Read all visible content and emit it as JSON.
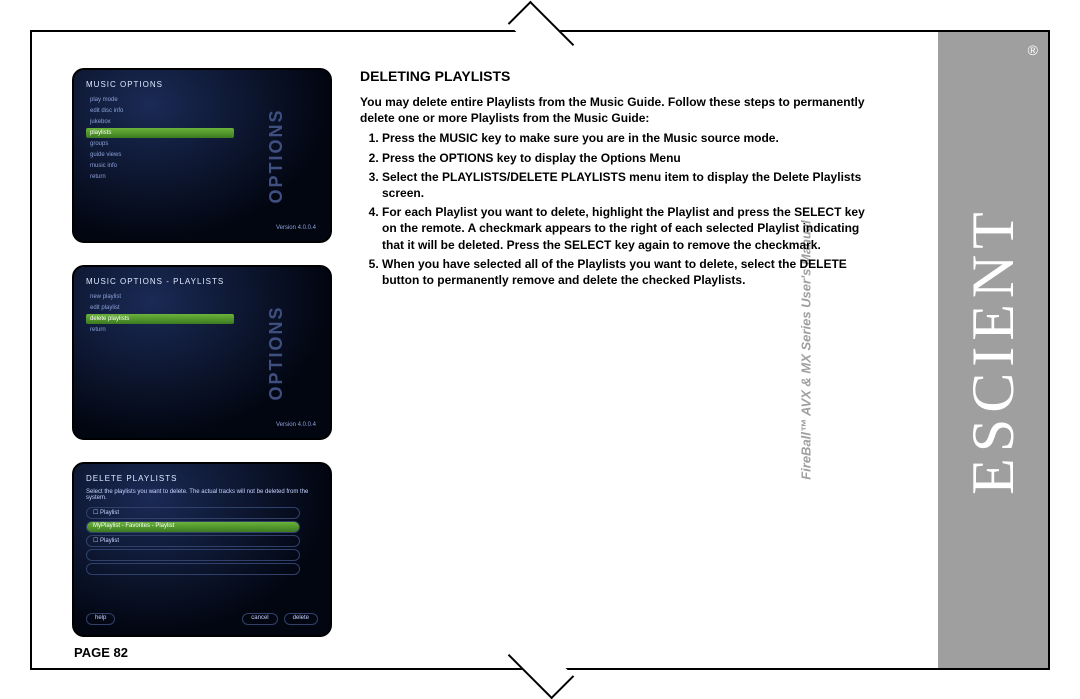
{
  "page_label": "PAGE 82",
  "brand": "ESCIENT",
  "brand_sub": "FireBall™ AVX & MX Series User's Manual",
  "heading": "DELETING PLAYLISTS",
  "intro": "You may delete entire Playlists from the Music Guide. Follow these steps to permanently delete one or more Playlists from the Music Guide:",
  "steps": [
    "Press the MUSIC key to make sure you are in the Music source mode.",
    "Press the OPTIONS key to display the Options Menu",
    "Select the PLAYLISTS/DELETE PLAYLISTS menu item to display the Delete Playlists screen.",
    "For each Playlist you want to delete, highlight the Playlist and press the SELECT key on the remote. A checkmark appears to the right of each selected Playlist indicating that it will be deleted. Press the SELECT key again to remove the checkmark.",
    "When you have selected all of the Playlists you want to delete, select the DELETE button to permanently remove and delete the checked Playlists."
  ],
  "screen1": {
    "side": "OPTIONS",
    "title": "MUSIC OPTIONS",
    "items": [
      "play mode",
      "edit disc info",
      "jukebox",
      "playlists",
      "groups",
      "guide views",
      "music info",
      "return"
    ],
    "selected_index": 3,
    "version": "Version 4.0.0.4"
  },
  "screen2": {
    "side": "OPTIONS",
    "title": "MUSIC OPTIONS - PLAYLISTS",
    "items": [
      "new playlist",
      "edit playlist",
      "delete playlists",
      "return"
    ],
    "selected_index": 2,
    "version": "Version 4.0.0.4"
  },
  "screen3": {
    "title": "DELETE PLAYLISTS",
    "desc": "Select the playlists you want to delete. The actual tracks will not be deleted from the system.",
    "rows": [
      "☐  Playlist",
      "MyPlaylist - Favorites - Playlist",
      "☐  Playlist"
    ],
    "selected_index": 1,
    "buttons": {
      "help": "help",
      "cancel": "cancel",
      "delete": "delete"
    }
  },
  "registered": "®"
}
